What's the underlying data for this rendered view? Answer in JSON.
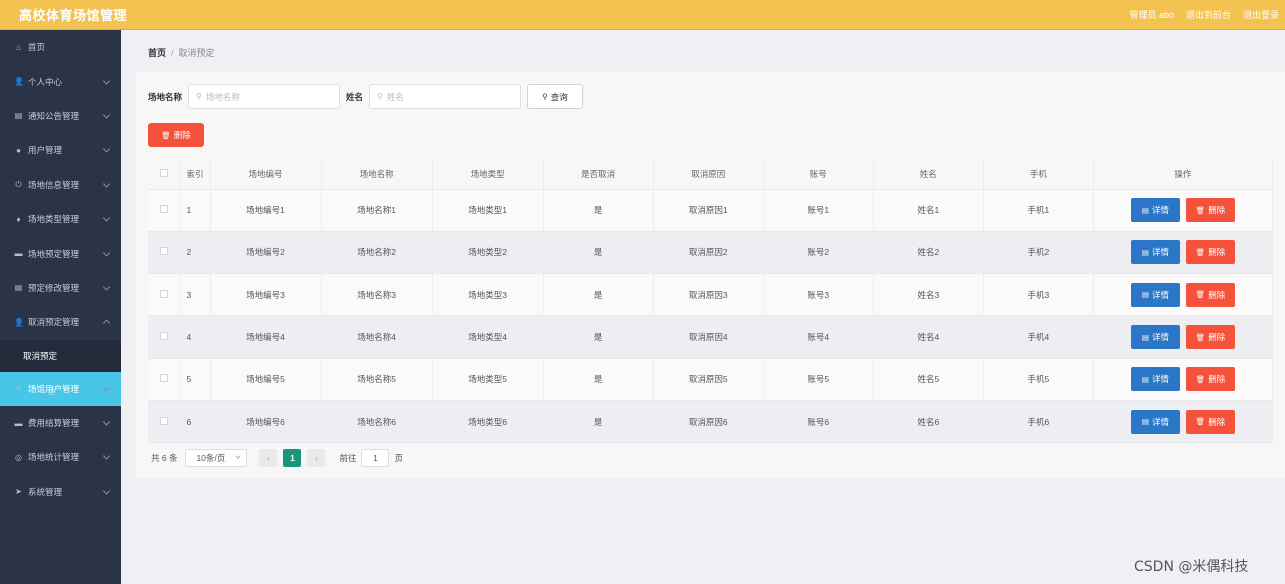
{
  "header": {
    "title": "高校体育场馆管理",
    "admin_label": "管理员 abo",
    "backend_label": "退出到前台",
    "logout_label": "退出登录"
  },
  "sidebar": {
    "items": [
      {
        "label": "首页",
        "icon": "home-icon",
        "glyph": "⌂"
      },
      {
        "label": "个人中心",
        "icon": "user-icon",
        "glyph": "👤"
      },
      {
        "label": "通知公告管理",
        "icon": "notice-icon",
        "glyph": "▤"
      },
      {
        "label": "用户管理",
        "icon": "user-group-icon",
        "glyph": "●"
      },
      {
        "label": "场地信息管理",
        "icon": "power-icon",
        "glyph": "⏻"
      },
      {
        "label": "场地类型管理",
        "icon": "mic-icon",
        "glyph": "♦"
      },
      {
        "label": "场地预定管理",
        "icon": "chat-icon",
        "glyph": "▬"
      },
      {
        "label": "预定修改管理",
        "icon": "doc-icon",
        "glyph": "▤"
      },
      {
        "label": "取消预定管理",
        "icon": "person-icon",
        "glyph": "👤"
      },
      {
        "label": "场馆用户管理",
        "icon": "list-icon",
        "glyph": "≡"
      },
      {
        "label": "费用结算管理",
        "icon": "message-icon",
        "glyph": "▬"
      },
      {
        "label": "场地统计管理",
        "icon": "target-icon",
        "glyph": "◎"
      },
      {
        "label": "系统管理",
        "icon": "send-icon",
        "glyph": "➤"
      }
    ],
    "submenu": {
      "label": "取消预定"
    }
  },
  "breadcrumb": {
    "home": "首页",
    "separator": "/",
    "current": "取消预定"
  },
  "search": {
    "venue_name_label": "场地名称",
    "venue_name_placeholder": "场地名称",
    "name_label": "姓名",
    "name_placeholder": "姓名",
    "query_label": "查询"
  },
  "toolbar": {
    "delete_label": "删除"
  },
  "table": {
    "headers": [
      "索引",
      "场地编号",
      "场地名称",
      "场地类型",
      "是否取消",
      "取消原因",
      "账号",
      "姓名",
      "手机",
      "操作"
    ],
    "rows": [
      {
        "idx": "1",
        "code": "场地编号1",
        "name": "场地名称1",
        "type": "场地类型1",
        "cancelled": "是",
        "reason": "取消原因1",
        "account": "账号1",
        "person": "姓名1",
        "phone": "手机1"
      },
      {
        "idx": "2",
        "code": "场地编号2",
        "name": "场地名称2",
        "type": "场地类型2",
        "cancelled": "是",
        "reason": "取消原因2",
        "account": "账号2",
        "person": "姓名2",
        "phone": "手机2"
      },
      {
        "idx": "3",
        "code": "场地编号3",
        "name": "场地名称3",
        "type": "场地类型3",
        "cancelled": "是",
        "reason": "取消原因3",
        "account": "账号3",
        "person": "姓名3",
        "phone": "手机3"
      },
      {
        "idx": "4",
        "code": "场地编号4",
        "name": "场地名称4",
        "type": "场地类型4",
        "cancelled": "是",
        "reason": "取消原因4",
        "account": "账号4",
        "person": "姓名4",
        "phone": "手机4"
      },
      {
        "idx": "5",
        "code": "场地编号5",
        "name": "场地名称5",
        "type": "场地类型5",
        "cancelled": "是",
        "reason": "取消原因5",
        "account": "账号5",
        "person": "姓名5",
        "phone": "手机5"
      },
      {
        "idx": "6",
        "code": "场地编号6",
        "name": "场地名称6",
        "type": "场地类型6",
        "cancelled": "是",
        "reason": "取消原因6",
        "account": "账号6",
        "person": "姓名6",
        "phone": "手机6"
      }
    ],
    "detail_label": "详情",
    "delete_label": "删除"
  },
  "pagination": {
    "total_label": "共 6 条",
    "page_size": "10条/页",
    "prev": "‹",
    "current_page": "1",
    "next": "›",
    "goto_label": "前往",
    "goto_value": "1",
    "page_suffix": "页"
  },
  "watermark": "CSDN @米偶科技",
  "colors": {
    "header_bg": "#f3c352",
    "sidebar_bg": "#2b3447",
    "active_menu": "#47c6e8",
    "delete_red": "#f4523b",
    "detail_blue": "#2b76c6",
    "page_green": "#19977a"
  }
}
